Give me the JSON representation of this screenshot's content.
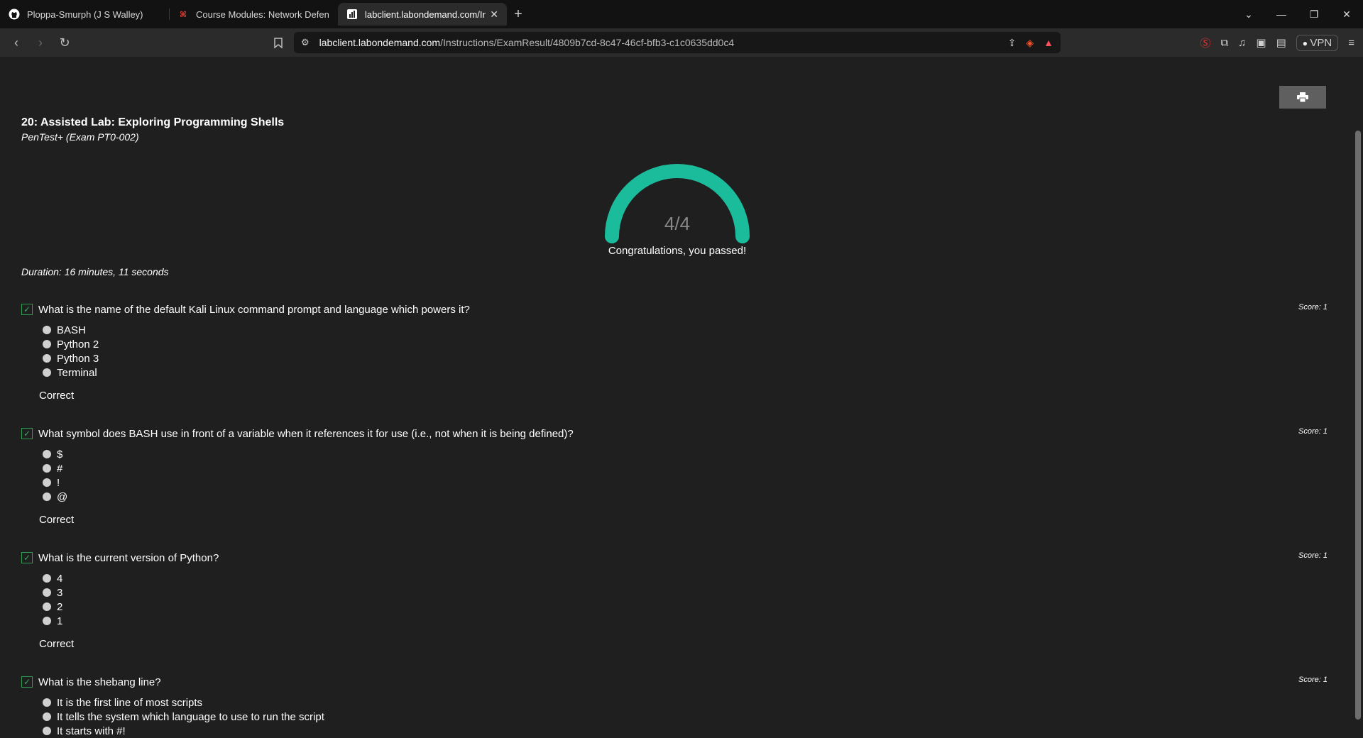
{
  "browser": {
    "tabs": [
      {
        "title": "Ploppa-Smurph (J S Walley)",
        "icon": "github-icon"
      },
      {
        "title": "Course Modules: Network Defense (",
        "icon": "course-icon"
      },
      {
        "title": "labclient.labondemand.com/Inst",
        "icon": "labondemand-icon"
      }
    ],
    "url_host": "labclient.labondemand.com",
    "url_path": "/Instructions/ExamResult/4809b7cd-8c47-46cf-bfb3-c1c0635dd0c4",
    "vpn_label": "VPN"
  },
  "page": {
    "print_icon": "printer-icon",
    "lab_title": "20: Assisted Lab: Exploring Programming Shells",
    "lab_subtitle": "PenTest+ (Exam PT0-002)",
    "score_text": "4/4",
    "score_fraction": 1.0,
    "gauge_color": "#1abc9c",
    "congrats": "Congratulations, you passed!",
    "duration": "Duration: 16 minutes, 11 seconds"
  },
  "questions": [
    {
      "text": "What is the name of the default Kali Linux command prompt and language which powers it?",
      "score": "Score: 1",
      "options": [
        "BASH",
        "Python 2",
        "Python 3",
        "Terminal"
      ],
      "result": "Correct"
    },
    {
      "text": "What symbol does BASH use in front of a variable when it references it for use (i.e., not when it is being defined)?",
      "score": "Score: 1",
      "options": [
        "$",
        "#",
        "!",
        "@"
      ],
      "result": "Correct"
    },
    {
      "text": "What is the current version of Python?",
      "score": "Score: 1",
      "options": [
        "4",
        "3",
        "2",
        "1"
      ],
      "result": "Correct"
    },
    {
      "text": "What is the shebang line?",
      "score": "Score: 1",
      "options": [
        "It is the first line of most scripts",
        "It tells the system which language to use to run the script",
        "It starts with #!"
      ],
      "result": ""
    }
  ]
}
